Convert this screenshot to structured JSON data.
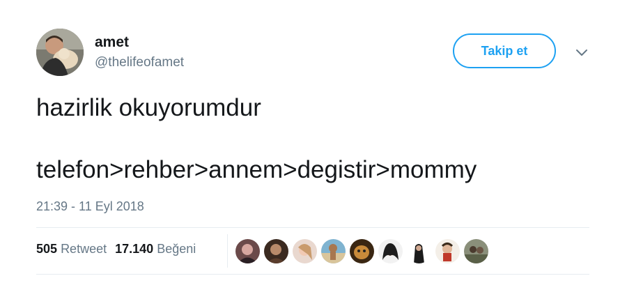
{
  "user": {
    "name": "amet",
    "handle": "@thelifeofamet"
  },
  "follow_button": {
    "label": "Takip et"
  },
  "tweet": {
    "line1": "hazirlik okuyorumdur",
    "line2": "telefon>rehber>annem>degistir>mommy"
  },
  "timestamp": "21:39 - 11 Eyl 2018",
  "stats": {
    "retweet_count": "505",
    "retweet_label": "Retweet",
    "like_count": "17.140",
    "like_label": "Beğeni"
  },
  "colors": {
    "accent": "#1da1f2",
    "secondary_text": "#657786",
    "primary_text": "#14171a",
    "divider": "#e6ecf0"
  },
  "icons": {
    "menu": "chevron-down-icon"
  }
}
